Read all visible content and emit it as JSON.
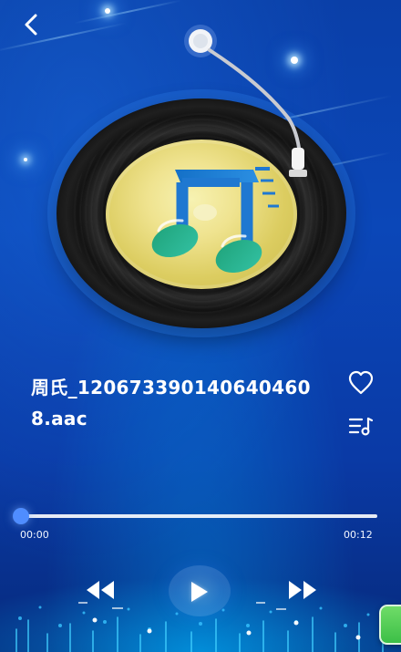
{
  "player": {
    "song_title": "周氏_1206733901406404608.aac",
    "time_elapsed": "00:00",
    "time_total": "00:12",
    "progress": 0
  },
  "icons": {
    "back": "back-arrow-icon",
    "favorite": "heart-icon",
    "playlist": "playlist-icon",
    "previous": "rewind-icon",
    "play": "play-icon",
    "next": "fast-forward-icon",
    "floating": "floating-app-icon"
  },
  "colors": {
    "background_top": "#0a3fa8",
    "background_bottom": "#062a7c",
    "accent": "#4f8dff",
    "disc_label": "#e8dc7a",
    "note_teal": "#2bb397",
    "note_blue": "#1f78d1"
  }
}
